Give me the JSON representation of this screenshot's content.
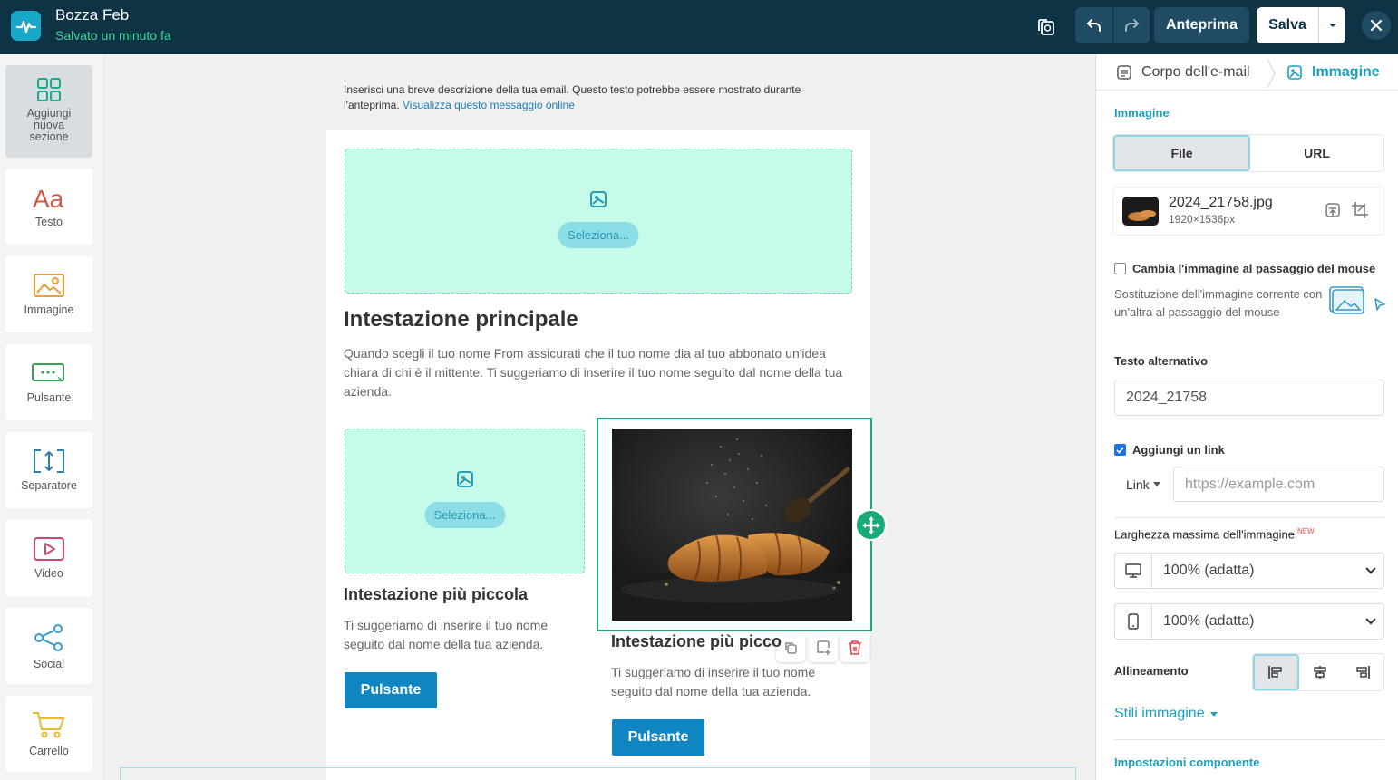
{
  "header": {
    "title": "Bozza Feb",
    "status": "Salvato un minuto fa",
    "preview_label": "Anteprima",
    "save_label": "Salva"
  },
  "sidebar": {
    "items": [
      {
        "label": "Aggiungi nuova sezione",
        "icon": "grid-icon"
      },
      {
        "label": "Testo",
        "icon": "text-aa-icon"
      },
      {
        "label": "Immagine",
        "icon": "image-icon"
      },
      {
        "label": "Pulsante",
        "icon": "button-icon"
      },
      {
        "label": "Separatore",
        "icon": "separator-icon"
      },
      {
        "label": "Video",
        "icon": "video-icon"
      },
      {
        "label": "Social",
        "icon": "share-icon"
      },
      {
        "label": "Carrello",
        "icon": "cart-icon"
      }
    ]
  },
  "canvas": {
    "preheader": "Inserisci una breve descrizione della tua email. Questo testo potrebbe essere mostrato durante l'anteprima.",
    "preheader_link": "Visualizza questo messaggio online",
    "select_label": "Seleziona...",
    "main_heading": "Intestazione principale",
    "main_paragraph": "Quando scegli il tuo nome From assicurati che il tuo nome dia al tuo abbonato un'idea chiara di chi è il mittente. Ti suggeriamo di inserire il tuo nome seguito dal nome della tua azienda.",
    "col_left": {
      "heading": "Intestazione più piccola",
      "paragraph": "Ti suggeriamo di inserire il tuo nome seguito dal nome della tua azienda.",
      "button": "Pulsante"
    },
    "col_right": {
      "heading": "Intestazione più picco",
      "paragraph": "Ti suggeriamo di inserire il tuo nome seguito dal nome della tua azienda.",
      "button": "Pulsante"
    }
  },
  "panel": {
    "breadcrumb_parent": "Corpo dell'e-mail",
    "breadcrumb_current": "Immagine",
    "section_image": "Immagine",
    "source_tabs": [
      "File",
      "URL"
    ],
    "active_source": "File",
    "file_name": "2024_21758.jpg",
    "file_dims": "1920×1536px",
    "hover_label": "Cambia l'immagine al passaggio del mouse",
    "hover_checked": false,
    "hover_hint": "Sostituzione dell'immagine corrente con un'altra al passaggio del mouse",
    "alt_label": "Testo alternativo",
    "alt_value": "2024_21758",
    "link_label": "Aggiungi un link",
    "link_checked": true,
    "link_type": "Link",
    "link_placeholder": "https://example.com",
    "max_width_label": "Larghezza massima dell'immagine",
    "new_badge": "NEW",
    "desktop_width": "100% (adatta)",
    "mobile_width": "100% (adatta)",
    "align_label": "Allineamento",
    "align_selected": "left",
    "styles_label": "Stili immagine",
    "component_settings": "Impostazioni componente"
  },
  "colors": {
    "topbar": "#0d3345",
    "accent": "#1aa0bf",
    "status_green": "#3ed39b",
    "placeholder_bg": "#c6fbea",
    "button_blue": "#0f86c2",
    "selection_green": "#1aaa7a"
  }
}
